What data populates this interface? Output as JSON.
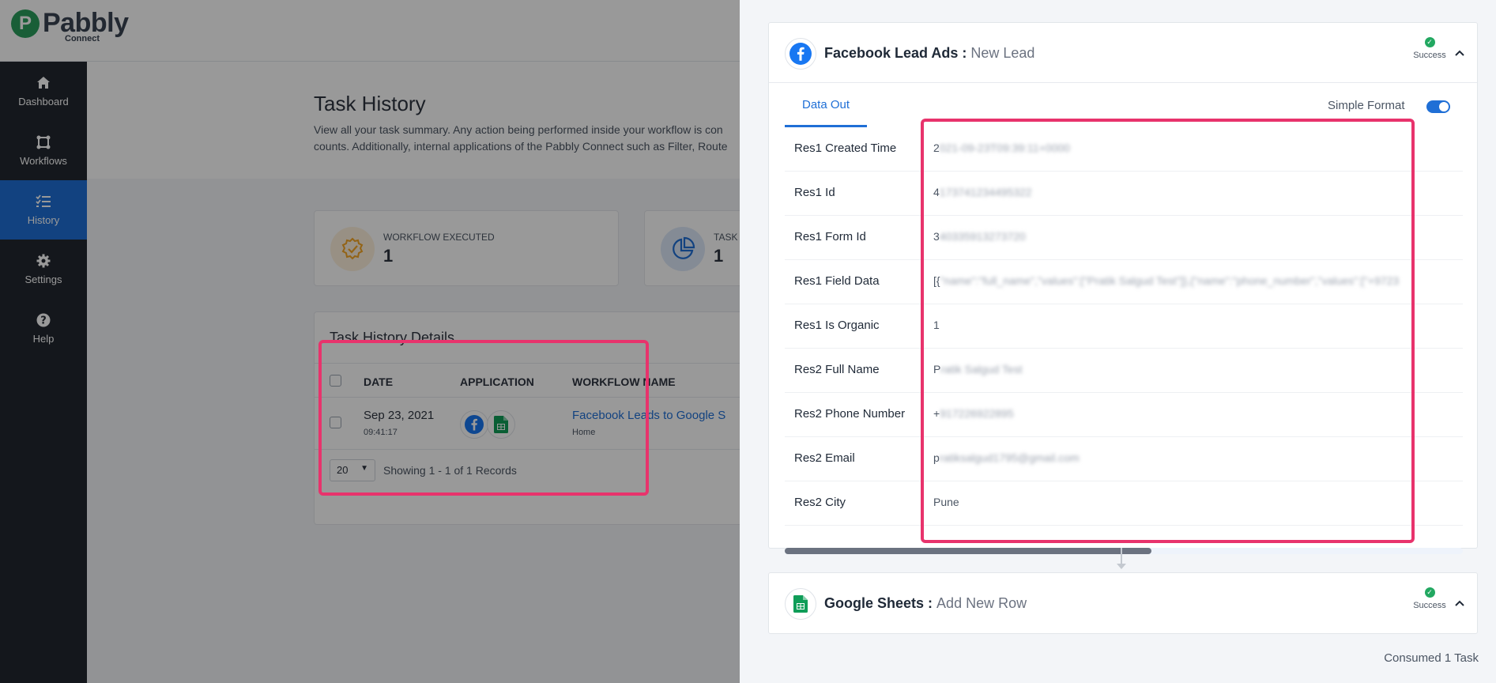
{
  "logo": {
    "mark": "P",
    "name": "Pabbly",
    "sub": "Connect"
  },
  "sidebar": {
    "items": [
      {
        "label": "Dashboard",
        "icon": "home-icon",
        "active": false
      },
      {
        "label": "Workflows",
        "icon": "workflow-icon",
        "active": false
      },
      {
        "label": "History",
        "icon": "history-icon",
        "active": true
      },
      {
        "label": "Settings",
        "icon": "gear-icon",
        "active": false
      },
      {
        "label": "Help",
        "icon": "help-icon",
        "active": false
      }
    ]
  },
  "page": {
    "title": "Task History",
    "description": "View all your task summary. Any action being performed inside your workflow is con counts. Additionally, internal applications of the Pabbly Connect such as Filter, Route"
  },
  "stats": [
    {
      "label": "WORKFLOW EXECUTED",
      "value": "1",
      "icon": "badge-check-icon",
      "color": "#f5a623"
    },
    {
      "label": "TASK C",
      "value": "1",
      "icon": "pie-chart-icon",
      "color": "#1f6fd6"
    }
  ],
  "details": {
    "title": "Task History Details",
    "columns": [
      "DATE",
      "APPLICATION",
      "WORKFLOW NAME"
    ],
    "rows": [
      {
        "date": "Sep 23, 2021",
        "time": "09:41:17",
        "apps": [
          "facebook-icon",
          "google-sheets-icon"
        ],
        "workflow": "Facebook Leads to Google S",
        "folder": "Home"
      }
    ],
    "per_page": "20",
    "showing": "Showing 1 - 1 of 1 Records"
  },
  "panel": {
    "steps": [
      {
        "app": "Facebook Lead Ads :",
        "event": "New Lead",
        "icon": "facebook-icon",
        "status": "Success",
        "tab": "Data Out",
        "simple_format_label": "Simple Format",
        "simple_format_on": true,
        "fields": [
          {
            "key": "Res1 Created Time",
            "value_visible": "2",
            "value_blurred": "021-09-23T09:39:11+0000"
          },
          {
            "key": "Res1 Id",
            "value_visible": "4",
            "value_blurred": "173741234495322"
          },
          {
            "key": "Res1 Form Id",
            "value_visible": "3",
            "value_blurred": "40335913273720"
          },
          {
            "key": "Res1 Field Data",
            "value_visible": "[{",
            "value_blurred": "\"name\":\"full_name\",\"values\":[\"Pratik Salgud Test\"]},{\"name\":\"phone_number\",\"values\":[\"+9723"
          },
          {
            "key": "Res1 Is Organic",
            "value_visible": "1",
            "value_blurred": ""
          },
          {
            "key": "Res2 Full Name",
            "value_visible": "P",
            "value_blurred": "ratik Salgud Test"
          },
          {
            "key": "Res2 Phone Number",
            "value_visible": "+",
            "value_blurred": "917226922895"
          },
          {
            "key": "Res2 Email",
            "value_visible": "p",
            "value_blurred": "ratiksalgud1795@gmail.com"
          },
          {
            "key": "Res2 City",
            "value_visible": "Pune",
            "value_blurred": ""
          }
        ]
      },
      {
        "app": "Google Sheets :",
        "event": "Add New Row",
        "icon": "google-sheets-icon",
        "status": "Success"
      }
    ],
    "consumed": "Consumed 1 Task"
  },
  "colors": {
    "accent": "#1f6fd6",
    "success": "#22a861",
    "annotation": "#e8336c",
    "sidebar": "#22272f"
  }
}
